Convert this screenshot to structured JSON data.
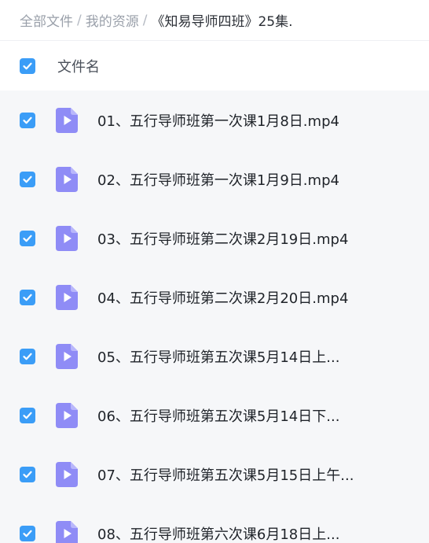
{
  "breadcrumb": {
    "items": [
      "全部文件",
      "我的资源"
    ],
    "separator": "/",
    "current": "《知易导师四班》25集."
  },
  "list_header": {
    "select_all_checked": true,
    "column_label": "文件名"
  },
  "files": [
    {
      "name": "01、五行导师班第一次课1月8日.mp4",
      "checked": true,
      "icon": "video-file-icon"
    },
    {
      "name": "02、五行导师班第一次课1月9日.mp4",
      "checked": true,
      "icon": "video-file-icon"
    },
    {
      "name": "03、五行导师班第二次课2月19日.mp4",
      "checked": true,
      "icon": "video-file-icon"
    },
    {
      "name": "04、五行导师班第二次课2月20日.mp4",
      "checked": true,
      "icon": "video-file-icon"
    },
    {
      "name": "05、五行导师班第五次课5月14日上...",
      "checked": true,
      "icon": "video-file-icon"
    },
    {
      "name": "06、五行导师班第五次课5月14日下...",
      "checked": true,
      "icon": "video-file-icon"
    },
    {
      "name": "07、五行导师班第五次课5月15日上午...",
      "checked": true,
      "icon": "video-file-icon"
    },
    {
      "name": "08、五行导师班第六次课6月18日上...",
      "checked": true,
      "icon": "video-file-icon"
    }
  ],
  "colors": {
    "accent": "#3b9df7",
    "video_icon": "#8f8cf6",
    "list_background": "#f6f7f9"
  }
}
